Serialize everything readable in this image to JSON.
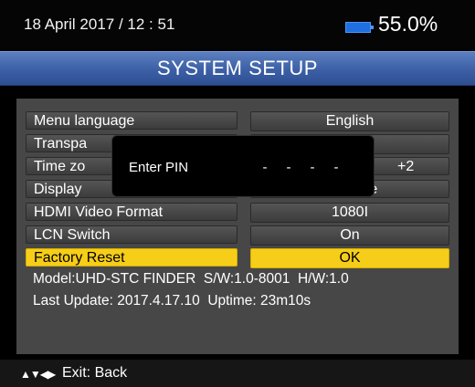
{
  "status": {
    "datetime": "18 April 2017 / 12 : 51",
    "battery_percent": "55.0%",
    "battery_icon": "battery-icon"
  },
  "title": "SYSTEM SETUP",
  "menu": {
    "rows": [
      {
        "label": "Menu language",
        "value": "English"
      },
      {
        "label": "Transpa",
        "value": ""
      },
      {
        "label": "Time zo",
        "value": "+2"
      },
      {
        "label": "Display",
        "value": "re"
      },
      {
        "label": "HDMI Video Format",
        "value": "1080I"
      },
      {
        "label": "LCN Switch",
        "value": "On"
      },
      {
        "label": "Factory Reset",
        "value": "OK",
        "selected": true
      }
    ]
  },
  "info": {
    "line1": "Model:UHD-STC FINDER  S/W:1.0-8001  H/W:1.0",
    "line2": "Last Update: 2017.4.17.10  Uptime: 23m10s"
  },
  "footer": {
    "nav_icon": "arrow-keys-icon",
    "nav_glyphs": "▲▼◀▶",
    "exit_label": "Exit: Back"
  },
  "pin_dialog": {
    "label": "Enter PIN",
    "slots": [
      "-",
      "-",
      "-",
      "-"
    ]
  },
  "colors": {
    "selected_row": "#f6cd18",
    "title_bar": "#3c5fa5",
    "battery": "#1f6fe0"
  }
}
